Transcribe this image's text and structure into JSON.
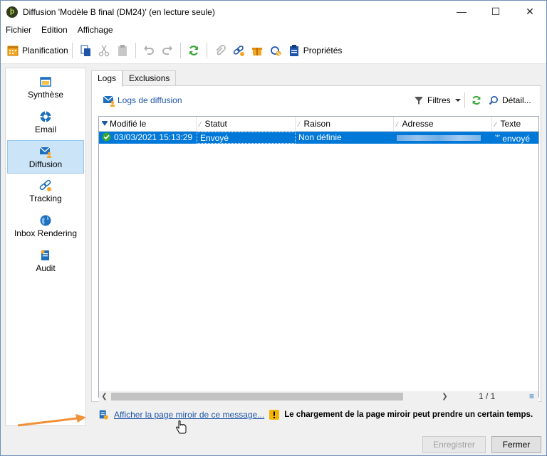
{
  "window": {
    "title": "Diffusion 'Modèle B final (DM24)' (en lecture seule)",
    "app_icon": "leaf-logo",
    "minimize_label": "—",
    "maximize_label": "☐",
    "close_label": "✕"
  },
  "menu": [
    {
      "label": "Fichier"
    },
    {
      "label": "Edition"
    },
    {
      "label": "Affichage"
    }
  ],
  "toolbar": {
    "planification_label": "Planification",
    "proprietes_label": "Propriétés"
  },
  "sidebar": {
    "items": [
      {
        "label": "Synthèse",
        "icon": "window-icon"
      },
      {
        "label": "Email",
        "icon": "lifebuoy-icon"
      },
      {
        "label": "Diffusion",
        "icon": "envelope-person-icon",
        "active": true
      },
      {
        "label": "Tracking",
        "icon": "chain-link-icon"
      },
      {
        "label": "Inbox Rendering",
        "icon": "globe-icon"
      },
      {
        "label": "Audit",
        "icon": "document-audit-icon"
      }
    ]
  },
  "tabs": [
    {
      "label": "Logs",
      "active": true
    },
    {
      "label": "Exclusions",
      "active": false
    }
  ],
  "panel": {
    "logs_link": "Logs de diffusion",
    "filters_label": "Filtres",
    "detail_label": "Détail..."
  },
  "grid": {
    "columns": [
      "Modifié le",
      "Statut",
      "Raison",
      "Adresse",
      "Texte"
    ],
    "rows": [
      {
        "modified": "03/03/2021 15:13:29",
        "status": "Envoyé",
        "reason": "Non définie",
        "address": "",
        "text": "envoyé",
        "text_prefix": "'*'"
      }
    ],
    "pager": "1 / 1"
  },
  "bottom": {
    "mirror_link": "Afficher la page miroir de ce message...",
    "warning": "Le chargement de la page miroir peut prendre un certain temps."
  },
  "footer": {
    "save_label": "Enregistrer",
    "close_label": "Fermer"
  },
  "colors": {
    "selection": "#0078d7",
    "link": "#1f55a8",
    "annotation_arrow": "#f0913a",
    "warning": "#f4b400"
  }
}
